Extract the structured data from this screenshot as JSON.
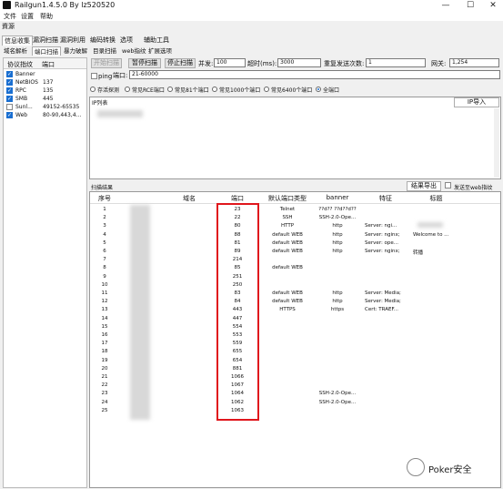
{
  "window": {
    "title": "Railgun1.4.5.0 By lz520520",
    "minimize": "—",
    "maximize": "☐",
    "close": "✕"
  },
  "menu": [
    "文件",
    "设置",
    "帮助"
  ],
  "section_title": "資源",
  "main_tabs": [
    "信息收集",
    "漏洞扫描",
    "漏洞利用",
    "编码转换",
    "选项",
    "辅助工具"
  ],
  "sub_tabs": [
    "域名解析",
    "端口扫描",
    "暴力破解",
    "目录扫描",
    "web指纹",
    "扩展选项"
  ],
  "left_panel": {
    "col1": "协议指纹",
    "col2": "端口",
    "rows": [
      {
        "name": "Banner",
        "port": "",
        "checked": true
      },
      {
        "name": "NetBIOS",
        "port": "137",
        "checked": true
      },
      {
        "name": "RPC",
        "port": "135",
        "checked": true
      },
      {
        "name": "SMB",
        "port": "445",
        "checked": true
      },
      {
        "name": "Sunl...",
        "port": "49152-65535",
        "checked": false
      },
      {
        "name": "Web",
        "port": "80-90,443,4...",
        "checked": true
      }
    ]
  },
  "toolbar": {
    "start": "开始扫描",
    "pause": "暂停扫描",
    "stop": "停止扫描",
    "concurrency_label": "并发:",
    "concurrency_value": "100",
    "timeout_label": "超时(ms):",
    "timeout_value": "3000",
    "resend_label": "重复发送次数:",
    "resend_value": "1",
    "gateway_label": "网关:",
    "gateway_value": "1,254"
  },
  "ping_row": {
    "ping": "ping",
    "port_label": "端口:",
    "port_value": "21-60000"
  },
  "radio_options": [
    "存活探测",
    "常见RCE端口",
    "常见81个端口",
    "常见1000个端口",
    "常见6400个端口",
    "全端口"
  ],
  "radio_selected": 5,
  "ip_list": {
    "label": "IP列表",
    "import": "IP导入"
  },
  "results": {
    "label": "扫描结果",
    "export": "结果导出",
    "send_web": "发送至web指纹",
    "columns": [
      "序号",
      "域名",
      "端口",
      "默认端口类型",
      "banner",
      "特征",
      "标题"
    ],
    "rows": [
      [
        "1",
        "",
        "23",
        "Telnet",
        "??d?? ??d??d??",
        "",
        ""
      ],
      [
        "2",
        "",
        "22",
        "SSH",
        "SSH-2.0-Ope...",
        "",
        ""
      ],
      [
        "3",
        "",
        "80",
        "HTTP",
        "http",
        "Server: ngi...",
        ""
      ],
      [
        "4",
        "",
        "88",
        "default WEB",
        "http",
        "Server: nginx;",
        "Welcome to ..."
      ],
      [
        "5",
        "",
        "81",
        "default WEB",
        "http",
        "Server: ope...",
        ""
      ],
      [
        "6",
        "",
        "89",
        "default WEB",
        "http",
        "Server: nginx;",
        "转播"
      ],
      [
        "7",
        "",
        "214",
        "",
        "",
        "",
        ""
      ],
      [
        "8",
        "",
        "85",
        "default WEB",
        "",
        "",
        ""
      ],
      [
        "9",
        "",
        "251",
        "",
        "",
        "",
        ""
      ],
      [
        "10",
        "",
        "250",
        "",
        "",
        "",
        ""
      ],
      [
        "11",
        "",
        "83",
        "default WEB",
        "http",
        "Server: Media;",
        ""
      ],
      [
        "12",
        "",
        "84",
        "default WEB",
        "http",
        "Server: Media;",
        ""
      ],
      [
        "13",
        "",
        "443",
        "HTTPS",
        "https",
        "Cert: TRAEF...",
        ""
      ],
      [
        "14",
        "",
        "447",
        "",
        "",
        "",
        ""
      ],
      [
        "15",
        "",
        "554",
        "",
        "",
        "",
        ""
      ],
      [
        "16",
        "",
        "553",
        "",
        "",
        "",
        ""
      ],
      [
        "17",
        "",
        "559",
        "",
        "",
        "",
        ""
      ],
      [
        "18",
        "",
        "655",
        "",
        "",
        "",
        ""
      ],
      [
        "19",
        "",
        "654",
        "",
        "",
        "",
        ""
      ],
      [
        "20",
        "",
        "881",
        "",
        "",
        "",
        ""
      ],
      [
        "21",
        "",
        "1066",
        "",
        "",
        "",
        ""
      ],
      [
        "22",
        "",
        "1067",
        "",
        "",
        "",
        ""
      ],
      [
        "23",
        "",
        "1064",
        "",
        "SSH-2.0-Ope...",
        "",
        ""
      ],
      [
        "24",
        "",
        "1062",
        "",
        "SSH-2.0-Ope...",
        "",
        ""
      ],
      [
        "25",
        "",
        "1063",
        "",
        "",
        "",
        ""
      ]
    ]
  },
  "watermark": "Poker安全"
}
